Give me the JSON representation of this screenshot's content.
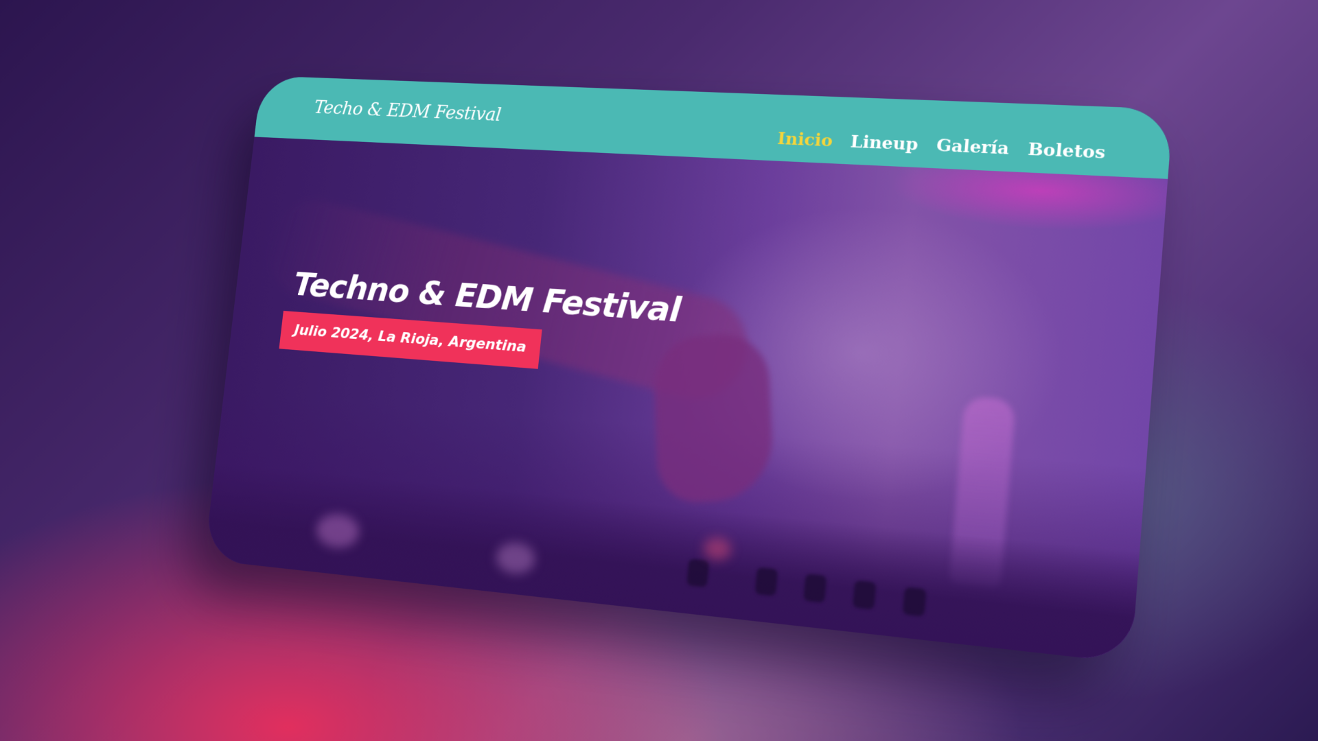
{
  "site": {
    "brand": "Techo & EDM Festival"
  },
  "nav": {
    "items": [
      {
        "label": "Inicio",
        "active": true
      },
      {
        "label": "Lineup",
        "active": false
      },
      {
        "label": "Galería",
        "active": false
      },
      {
        "label": "Boletos",
        "active": false
      }
    ]
  },
  "hero": {
    "title": "Techno & EDM Festival",
    "subtitle": "Julio 2024, La Rioja, Argentina"
  },
  "colors": {
    "header_bg": "#4bb9b4",
    "nav_active": "#f5d53a",
    "nav_text": "#ffffff",
    "subtitle_badge": "#f0325a",
    "hero_overlay": "#472777"
  }
}
